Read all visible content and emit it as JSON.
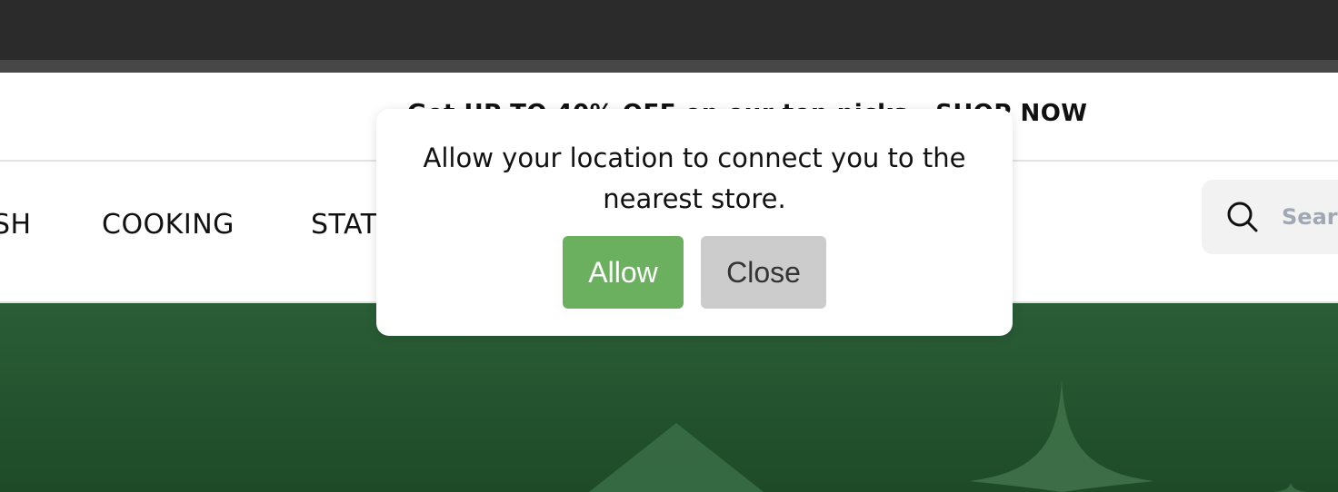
{
  "announcement": {
    "text": "Get UP TO 40% OFF on our top picks - SHOP NOW"
  },
  "nav": {
    "items": [
      {
        "label": "SH"
      },
      {
        "label": "COOKING"
      },
      {
        "label": "STAT"
      }
    ]
  },
  "search": {
    "placeholder": "Search"
  },
  "location_modal": {
    "message": "Allow your location to connect you to the nearest store.",
    "allow_label": "Allow",
    "close_label": "Close"
  },
  "colors": {
    "allow_button": "#6ab05e",
    "close_button": "#cccccc",
    "hero_green": "#245431",
    "browser_chrome": "#2b2b2b"
  }
}
